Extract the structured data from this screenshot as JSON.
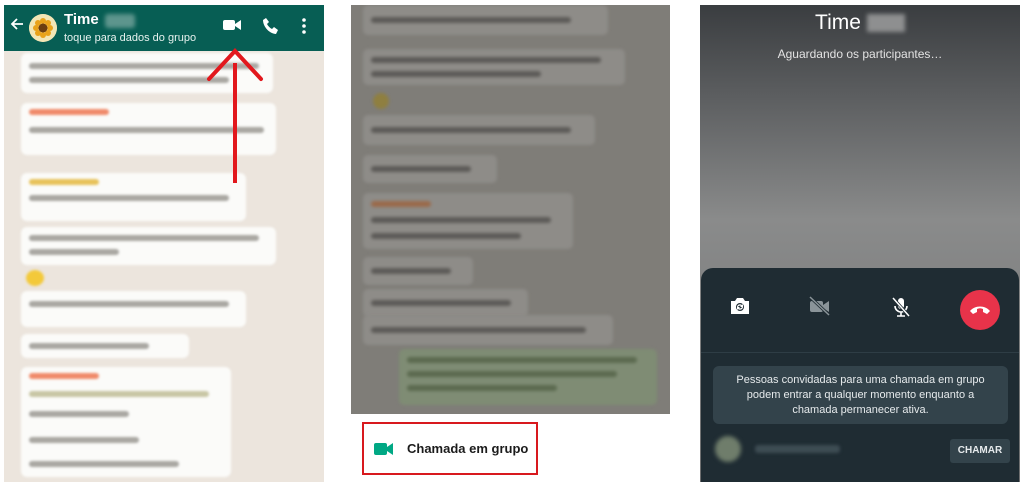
{
  "panel1": {
    "header": {
      "title": "Time",
      "subtitle": "toque para dados do grupo",
      "icons": [
        "back-arrow-icon",
        "group-avatar-icon",
        "video-call-icon",
        "voice-call-icon",
        "more-options-icon"
      ]
    },
    "annotation_color": "#e2181d",
    "header_color": "#075e54"
  },
  "panel2": {
    "menu_item_label": "Chamada em grupo",
    "menu_icon": "video-camera-icon",
    "highlight_color": "#d8191e",
    "icon_color": "#00a884"
  },
  "panel3": {
    "call_title": "Time",
    "status": "Aguardando os participantes…",
    "notice": "Pessoas convidadas para uma chamada em grupo podem entrar a qualquer momento enquanto a chamada permanecer ativa.",
    "call_button_label": "CHAMAR",
    "controls": [
      "switch-camera-icon",
      "video-off-icon",
      "mic-off-icon",
      "end-call-icon"
    ],
    "end_call_color": "#e8334a"
  }
}
